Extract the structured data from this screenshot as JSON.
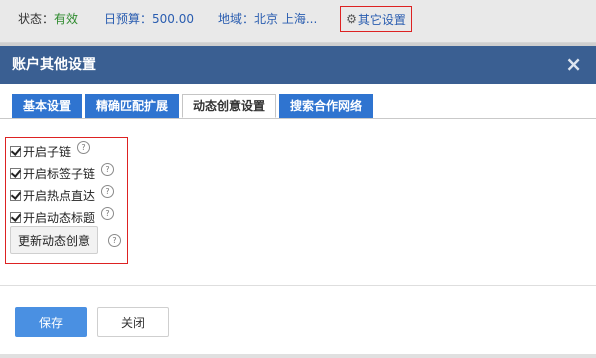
{
  "topbar": {
    "status_label": "状态：",
    "status_value": "有效",
    "budget_label": "日预算：",
    "budget_value": "500.00",
    "region_label": "地域：",
    "region_value": "北京 上海...",
    "other_settings_label": "其它设置",
    "other_settings_icon": "gear-icon"
  },
  "dialog": {
    "title": "账户其他设置",
    "close_glyph": "×",
    "tabs": [
      {
        "label": "基本设置",
        "active": false
      },
      {
        "label": "精确匹配扩展",
        "active": false
      },
      {
        "label": "动态创意设置",
        "active": true
      },
      {
        "label": "搜索合作网络",
        "active": false
      }
    ],
    "options": [
      {
        "label": "开启子链",
        "checked": true
      },
      {
        "label": "开启标签子链",
        "checked": true
      },
      {
        "label": "开启热点直达",
        "checked": true
      },
      {
        "label": "开启动态标题",
        "checked": true
      }
    ],
    "update_button": "更新动态创意",
    "help_glyph": "?",
    "save_button": "保存",
    "close_button": "关闭"
  },
  "colors": {
    "header_bg": "#3a5f92",
    "tab_bg": "#2f74d0",
    "save_bg": "#4a90e2",
    "highlight_border": "#dd2222",
    "status_green": "#2e8b2e"
  }
}
